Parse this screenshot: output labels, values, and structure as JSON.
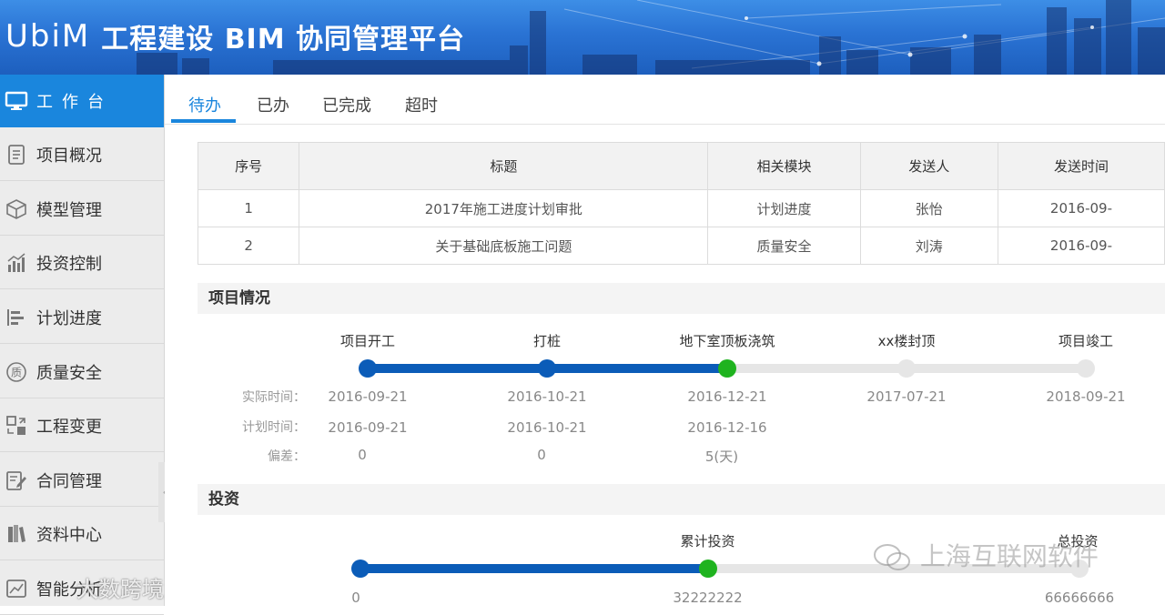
{
  "header": {
    "logo_text": "UbiM",
    "title": "工程建设 BIM 协同管理平台"
  },
  "sidebar": {
    "items": [
      {
        "label": "工作台",
        "icon": "monitor-icon"
      },
      {
        "label": "项目概况",
        "icon": "document-icon"
      },
      {
        "label": "模型管理",
        "icon": "cube-icon"
      },
      {
        "label": "投资控制",
        "icon": "bar-chart-icon"
      },
      {
        "label": "计划进度",
        "icon": "gantt-icon"
      },
      {
        "label": "质量安全",
        "icon": "quality-badge-icon"
      },
      {
        "label": "工程变更",
        "icon": "swap-icon"
      },
      {
        "label": "合同管理",
        "icon": "edit-document-icon"
      },
      {
        "label": "资料中心",
        "icon": "books-icon"
      },
      {
        "label": "智能分析",
        "icon": "analysis-icon"
      }
    ]
  },
  "tabs": [
    "待办",
    "已办",
    "已完成",
    "超时"
  ],
  "todo_table": {
    "columns": [
      "序号",
      "标题",
      "相关模块",
      "发送人",
      "发送时间"
    ],
    "rows": [
      [
        "1",
        "2017年施工进度计划审批",
        "计划进度",
        "张怡",
        "2016-09-"
      ],
      [
        "2",
        "关于基础底板施工问题",
        "质量安全",
        "刘涛",
        "2016-09-"
      ]
    ]
  },
  "project_status": {
    "title": "项目情况",
    "row_labels": {
      "actual": "实际时间：",
      "planned": "计划时间：",
      "deviation": "偏差："
    },
    "milestones": [
      {
        "name": "项目开工",
        "actual": "2016-09-21",
        "planned": "2016-09-21",
        "deviation": "0",
        "state": "done"
      },
      {
        "name": "打桩",
        "actual": "2016-10-21",
        "planned": "2016-10-21",
        "deviation": "0",
        "state": "done"
      },
      {
        "name": "地下室顶板浇筑",
        "actual": "2016-12-21",
        "planned": "2016-12-16",
        "deviation": "5(天)",
        "state": "current"
      },
      {
        "name": "xx楼封顶",
        "actual": "2017-07-21",
        "planned": "",
        "deviation": "",
        "state": "pending"
      },
      {
        "name": "项目竣工",
        "actual": "2018-09-21",
        "planned": "",
        "deviation": "",
        "state": "pending"
      }
    ]
  },
  "investment": {
    "title": "投资",
    "cumulative_label": "累计投资",
    "total_label": "总投资",
    "start_value": "0",
    "cumulative_value": "32222222",
    "total_value": "66666666",
    "progress_fraction": 0.483
  },
  "watermarks": {
    "wechat": "上海互联网软件",
    "corner": "大数跨境"
  },
  "colors": {
    "accent": "#1a86dd",
    "progress": "#0b5cb8",
    "current": "#1fb31f",
    "pending": "#e6e6e6"
  }
}
